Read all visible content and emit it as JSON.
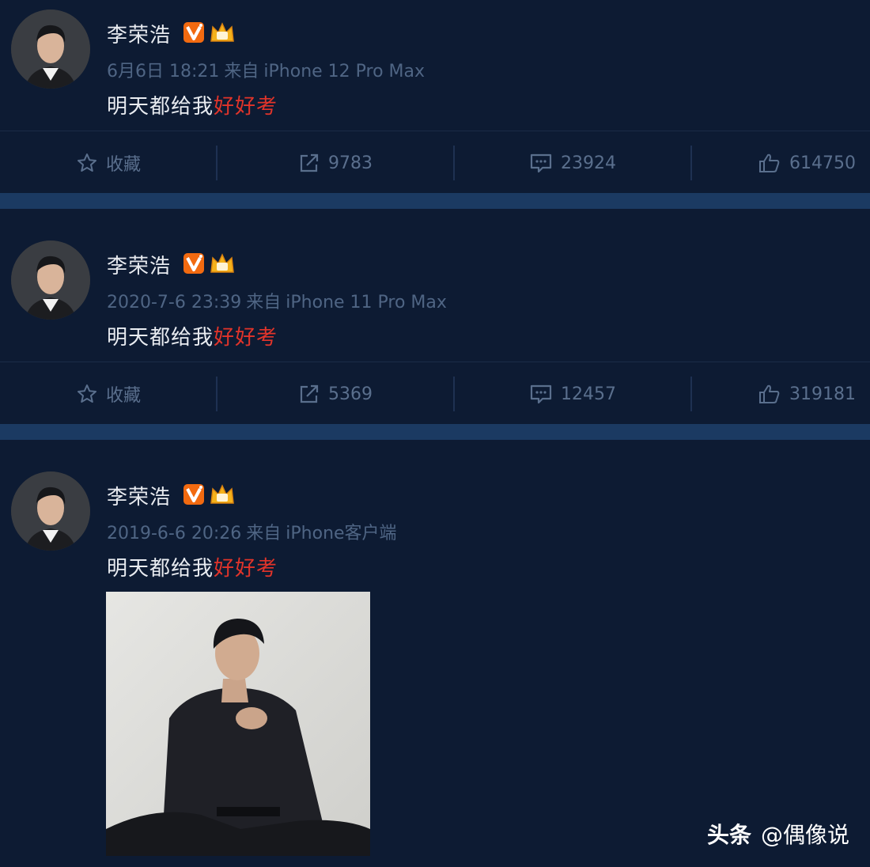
{
  "posts": [
    {
      "username": "李荣浩",
      "timestamp": "6月6日 18:21",
      "source_prefix": "来自",
      "source": "iPhone 12 Pro Max",
      "text_plain": "明天都给我",
      "text_highlight": "好好考",
      "actions": {
        "favorite_label": "收藏",
        "repost_count": "9783",
        "comment_count": "23924",
        "like_count": "614750"
      }
    },
    {
      "username": "李荣浩",
      "timestamp": "2020-7-6 23:39",
      "source_prefix": "来自",
      "source": "iPhone 11 Pro Max",
      "text_plain": "明天都给我",
      "text_highlight": "好好考",
      "actions": {
        "favorite_label": "收藏",
        "repost_count": "5369",
        "comment_count": "12457",
        "like_count": "319181"
      }
    },
    {
      "username": "李荣浩",
      "timestamp": "2019-6-6 20:26",
      "source_prefix": "来自",
      "source": "iPhone客户端",
      "text_plain": "明天都给我",
      "text_highlight": "好好考"
    }
  ],
  "watermark": {
    "brand": "头条",
    "handle": "@偶像说"
  },
  "colors": {
    "background": "#0d1b33",
    "separator": "#1b3a62",
    "highlight": "#e2342a",
    "meta": "#4f6584",
    "verified_badge": "#f26a10"
  },
  "icons": [
    "star-icon",
    "repost-icon",
    "comment-icon",
    "like-icon",
    "verified-v-icon",
    "crown-icon"
  ]
}
